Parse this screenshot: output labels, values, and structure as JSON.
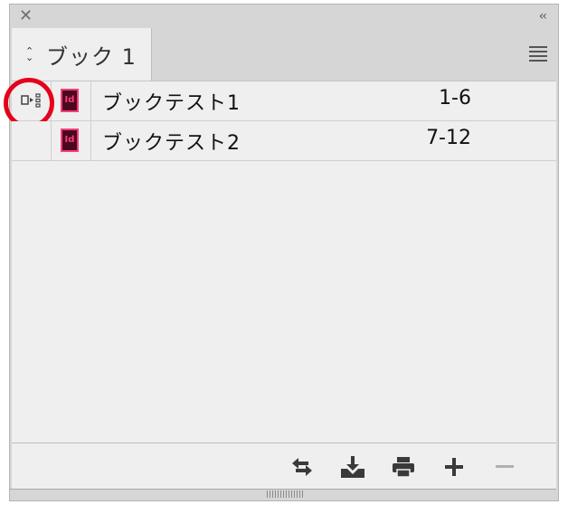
{
  "panel": {
    "close_glyph": "✕",
    "collapse_glyph": "‹‹"
  },
  "tab": {
    "arrows_up": "⌃",
    "arrows_down": "⌄",
    "label": "ブック 1"
  },
  "documents": [
    {
      "name": "ブックテスト1",
      "pages": "1-6",
      "icon": "indesign-doc-icon",
      "style_source": true
    },
    {
      "name": "ブックテスト2",
      "pages": "7-12",
      "icon": "indesign-doc-icon",
      "style_source": false
    }
  ],
  "indesign_icon_text": "Id",
  "footer_buttons": [
    {
      "icon": "synchronize-icon"
    },
    {
      "icon": "save-book-icon"
    },
    {
      "icon": "print-icon"
    },
    {
      "icon": "add-document-icon"
    },
    {
      "icon": "remove-document-icon",
      "disabled": true
    }
  ],
  "colors": {
    "panel_bg": "#efefef",
    "indesign_accent": "#ff3c7a",
    "highlight_circle": "#e5001c"
  }
}
